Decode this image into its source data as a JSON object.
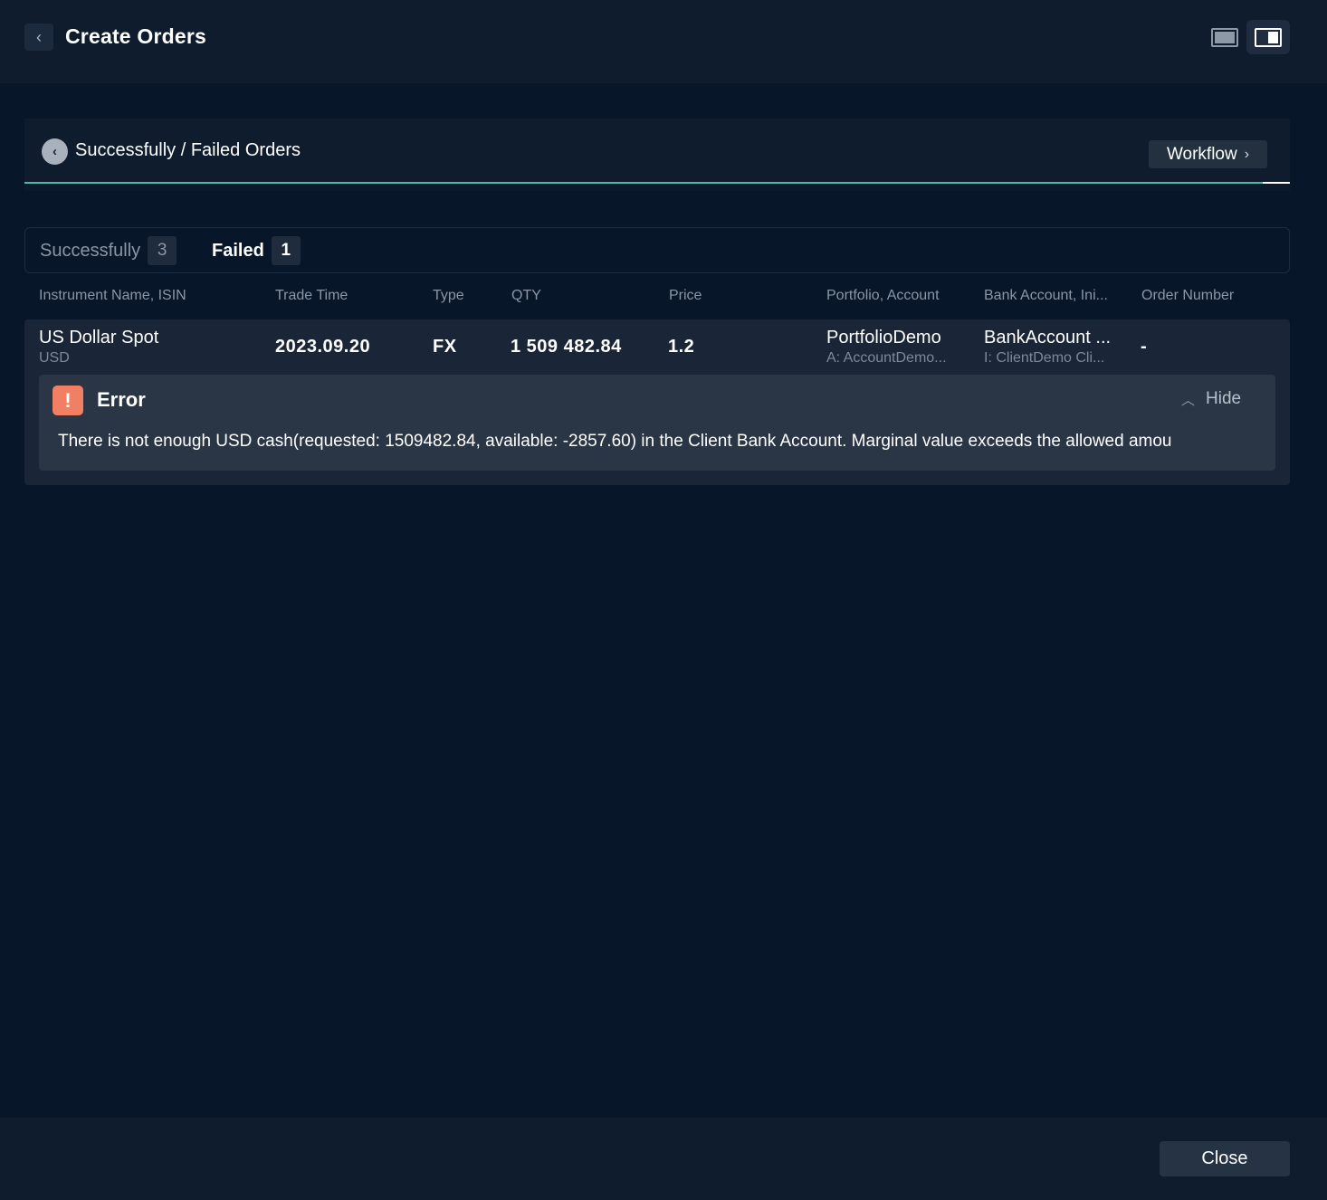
{
  "header": {
    "back_icon": "chevron-left-icon",
    "title": "Create Orders",
    "view_full_icon": "full-width-view-icon",
    "view_side_icon": "side-panel-view-icon"
  },
  "section": {
    "back_icon": "chevron-left-circle-icon",
    "title": "Successfully / Failed Orders",
    "workflow_label": "Workflow",
    "workflow_chevron": "›",
    "accent_color": "#4fb7ad"
  },
  "tabs": [
    {
      "label": "Successfully",
      "count": "3",
      "active": false
    },
    {
      "label": "Failed",
      "count": "1",
      "active": true
    }
  ],
  "columns": [
    "Instrument Name, ISIN",
    "Trade Time",
    "Type",
    "QTY",
    "Price",
    "Portfolio, Account",
    "Bank Account, Ini...",
    "Order Number"
  ],
  "row": {
    "instrument_name": "US Dollar Spot",
    "instrument_sub": "USD",
    "trade_time": "2023.09.20",
    "type": "FX",
    "qty": "1 509 482.84",
    "price": "1.2",
    "portfolio": "PortfolioDemo",
    "account": "A: AccountDemo...",
    "bank_account": "BankAccount ...",
    "initiator": "I: ClientDemo Cli...",
    "order_number": "-"
  },
  "error": {
    "icon_glyph": "!",
    "icon_color": "#f07f63",
    "title": "Error",
    "hide_label": "Hide",
    "hide_chevron": "︿",
    "message": "There is not enough USD cash(requested: 1509482.84, available: -2857.60) in the Client Bank Account. Marginal value exceeds the allowed amou"
  },
  "footer": {
    "close_label": "Close"
  }
}
